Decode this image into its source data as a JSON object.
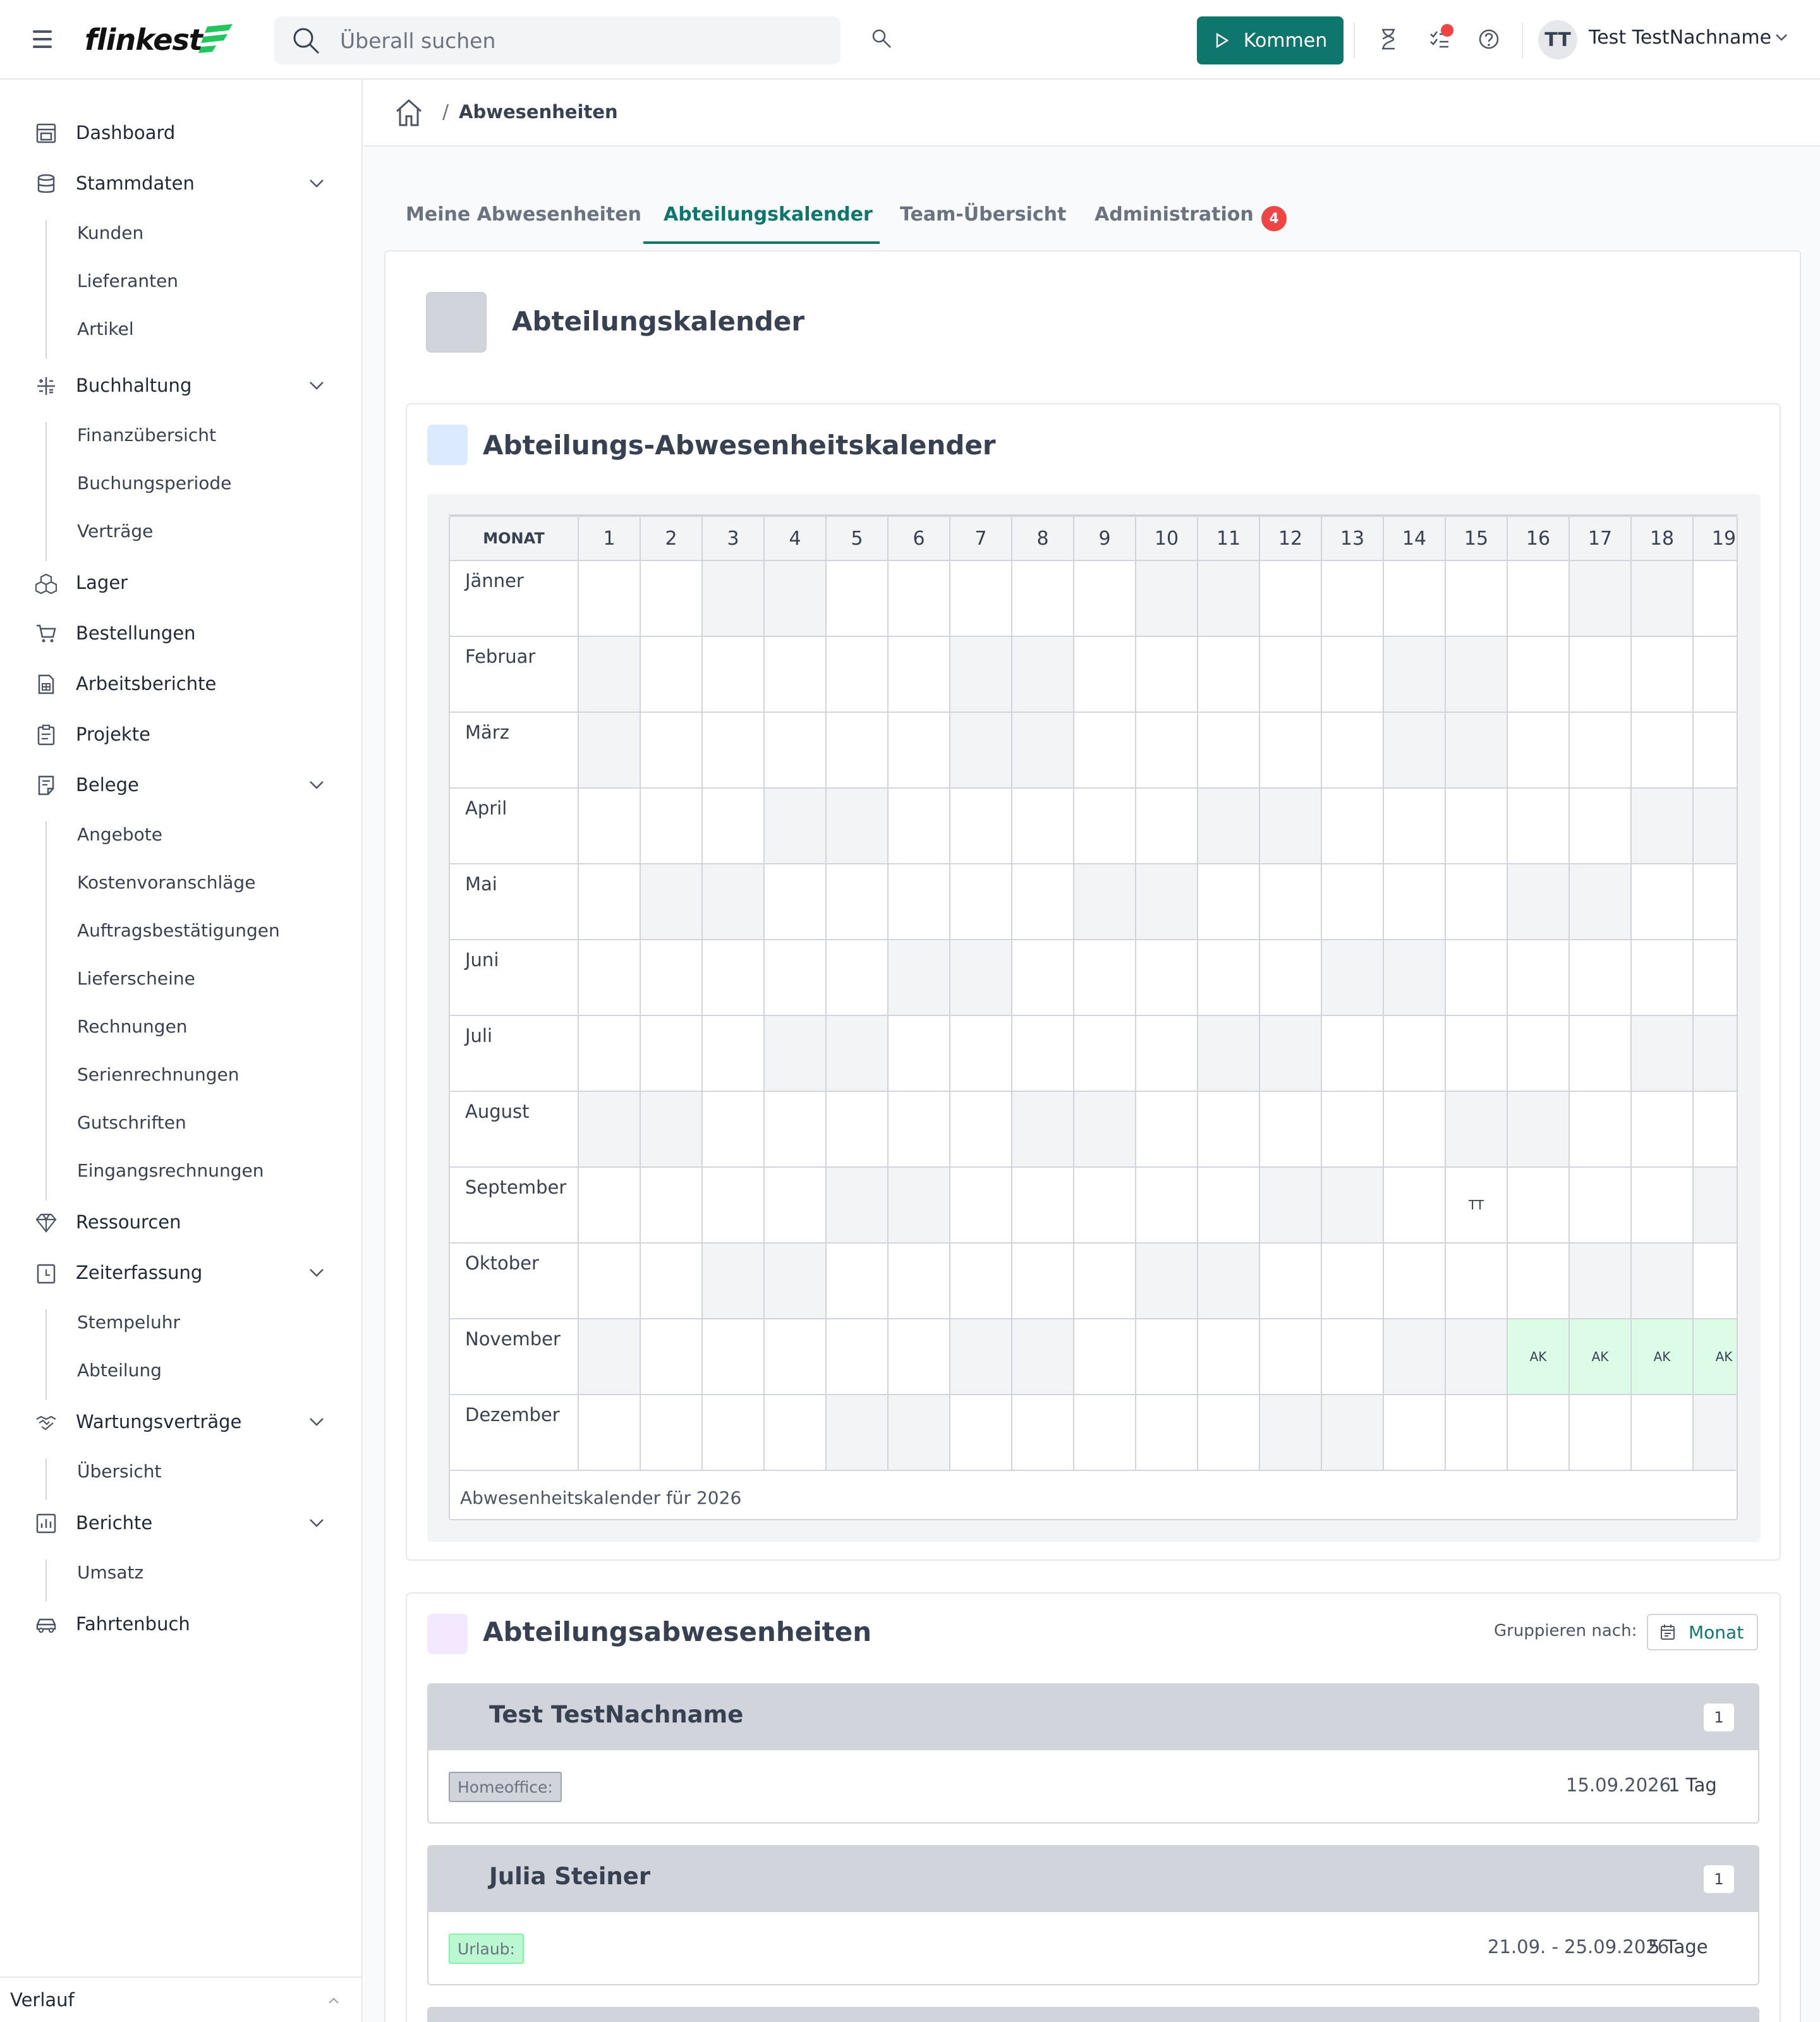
{
  "header": {
    "logo_text": "flinkest",
    "search_placeholder": "Überall suchen",
    "kommen_label": "Kommen",
    "user_initials": "TT",
    "user_name": "Test TestNachname"
  },
  "sidebar": {
    "items": [
      {
        "label": "Dashboard",
        "icon": "dashboard-icon"
      },
      {
        "label": "Stammdaten",
        "icon": "database-icon",
        "children": [
          "Kunden",
          "Lieferanten",
          "Artikel"
        ]
      },
      {
        "label": "Buchhaltung",
        "icon": "calculator-icon",
        "children": [
          "Finanzübersicht",
          "Buchungsperiode",
          "Verträge"
        ]
      },
      {
        "label": "Lager",
        "icon": "boxes-icon"
      },
      {
        "label": "Bestellungen",
        "icon": "cart-icon"
      },
      {
        "label": "Arbeitsberichte",
        "icon": "report-icon"
      },
      {
        "label": "Projekte",
        "icon": "clipboard-icon"
      },
      {
        "label": "Belege",
        "icon": "receipt-icon",
        "children": [
          "Angebote",
          "Kostenvoranschläge",
          "Auftragsbestätigungen",
          "Lieferscheine",
          "Rechnungen",
          "Serienrechnungen",
          "Gutschriften",
          "Eingangsrechnungen"
        ]
      },
      {
        "label": "Ressourcen",
        "icon": "diamond-icon"
      },
      {
        "label": "Zeiterfassung",
        "icon": "time-icon",
        "children": [
          "Stempeluhr",
          "Abteilung"
        ]
      },
      {
        "label": "Wartungsverträge",
        "icon": "handshake-icon",
        "children": [
          "Übersicht"
        ]
      },
      {
        "label": "Berichte",
        "icon": "chart-icon",
        "children": [
          "Umsatz"
        ]
      },
      {
        "label": "Fahrtenbuch",
        "icon": "car-icon"
      }
    ],
    "footer_label": "Verlauf"
  },
  "breadcrumb": {
    "separator": "/",
    "current": "Abwesenheiten"
  },
  "tabs": [
    {
      "label": "Meine Abwesenheiten",
      "active": false
    },
    {
      "label": "Abteilungskalender",
      "active": true
    },
    {
      "label": "Team-Übersicht",
      "active": false
    },
    {
      "label": "Administration",
      "active": false,
      "badge": "4"
    }
  ],
  "page_title": "Abteilungskalender",
  "calendar": {
    "title": "Abteilungs-Abwesenheitskalender",
    "month_header": "MONAT",
    "days": [
      "1",
      "2",
      "3",
      "4",
      "5",
      "6",
      "7",
      "8",
      "9",
      "10",
      "11",
      "12",
      "13",
      "14",
      "15",
      "16",
      "17",
      "18",
      "19"
    ],
    "months": [
      {
        "name": "Jänner",
        "weekend": [
          3,
          4,
          10,
          11,
          17,
          18
        ]
      },
      {
        "name": "Februar",
        "weekend": [
          1,
          7,
          8,
          14,
          15
        ]
      },
      {
        "name": "März",
        "weekend": [
          1,
          7,
          8,
          14,
          15
        ]
      },
      {
        "name": "April",
        "weekend": [
          4,
          5,
          11,
          12,
          18,
          19
        ]
      },
      {
        "name": "Mai",
        "weekend": [
          2,
          3,
          9,
          10,
          16,
          17
        ]
      },
      {
        "name": "Juni",
        "weekend": [
          6,
          7,
          13,
          14
        ]
      },
      {
        "name": "Juli",
        "weekend": [
          4,
          5,
          11,
          12,
          18,
          19
        ]
      },
      {
        "name": "August",
        "weekend": [
          1,
          2,
          8,
          9,
          15,
          16
        ]
      },
      {
        "name": "September",
        "weekend": [
          5,
          6,
          12,
          13,
          19
        ],
        "marks": [
          {
            "day": 15,
            "text": "TT"
          }
        ]
      },
      {
        "name": "Oktober",
        "weekend": [
          3,
          4,
          10,
          11,
          17,
          18
        ]
      },
      {
        "name": "November",
        "weekend": [
          1,
          7,
          8,
          14,
          15
        ],
        "marks": [
          {
            "day": 16,
            "text": "AK",
            "kind": "ak"
          },
          {
            "day": 17,
            "text": "AK",
            "kind": "ak"
          },
          {
            "day": 18,
            "text": "AK",
            "kind": "ak"
          },
          {
            "day": 19,
            "text": "AK",
            "kind": "ak"
          }
        ]
      },
      {
        "name": "Dezember",
        "weekend": [
          5,
          6,
          12,
          13,
          19
        ]
      }
    ],
    "footer": "Abwesenheitskalender für 2026"
  },
  "absences": {
    "title": "Abteilungsabwesenheiten",
    "group_label": "Gruppieren nach:",
    "group_value": "Monat",
    "people": [
      {
        "name": "Test TestNachname",
        "count": "1",
        "type": "Homeoffice:",
        "tag_color": "gray",
        "date": "15.09.2026",
        "duration": "1 Tag"
      },
      {
        "name": "Julia Steiner",
        "count": "1",
        "type": "Urlaub:",
        "tag_color": "green",
        "date": "21.09. - 25.09.2026",
        "duration": "5 Tage"
      }
    ]
  }
}
